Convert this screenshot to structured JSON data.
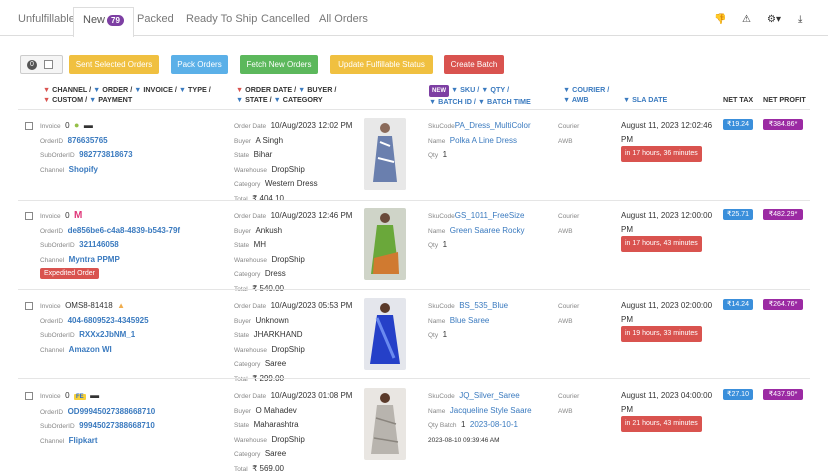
{
  "tabs": [
    {
      "label": "Unfulfillable"
    },
    {
      "label": "New",
      "count": "79"
    },
    {
      "label": "Packed"
    },
    {
      "label": "Ready To Ship"
    },
    {
      "label": "Cancelled"
    },
    {
      "label": "All Orders"
    }
  ],
  "selection_count": "0",
  "buttons": {
    "sent": "Sent Selected Orders",
    "pack": "Pack Orders",
    "fetch": "Fetch New Orders",
    "update": "Update Fulfillable Status",
    "batch": "Create Batch"
  },
  "colors": {
    "yellow": "#f0ad4e",
    "blue": "#5bc0de",
    "green": "#5cb85c",
    "red": "#d9534f",
    "purple": "#9b2aa3",
    "accent": "#3a7abf"
  },
  "headers": {
    "channel": "CHANNEL /",
    "order": "ORDER /",
    "invoice": "INVOICE /",
    "type": "TYPE /",
    "custom": "CUSTOM /",
    "payment": "PAYMENT",
    "order_date": "ORDER DATE /",
    "buyer": "BUYER /",
    "state": "STATE /",
    "category": "CATEGORY",
    "new_badge": "NEW",
    "sku": "SKU /",
    "qty": "QTY /",
    "batch_id": "BATCH ID /",
    "batch_time": "BATCH TIME",
    "courier": "COURIER /",
    "awb": "AWB",
    "sla_date": "SLA DATE",
    "net_tax": "NET TAX",
    "net_profit": "NET PROFIT"
  },
  "labels": {
    "invoice": "Invoice",
    "order_id": "OrderID",
    "suborder_id": "SubOrderID",
    "channel": "Channel",
    "order_date": "Order Date",
    "buyer": "Buyer",
    "state": "State",
    "warehouse": "Warehouse",
    "category": "Category",
    "total": "Total",
    "sku_code": "SkuCode",
    "name": "Name",
    "qty": "Qty",
    "qty_batch": "Qty Batch",
    "courier": "Courier",
    "awb": "AWB"
  },
  "orders": [
    {
      "invoice": "0",
      "order_id": "876635765",
      "suborder_id": "982773818673",
      "channel": "Shopify",
      "channel_icon": "shopify-icon",
      "order_date": "10/Aug/2023 12:02 PM",
      "buyer": "A Singh",
      "state": "Bihar",
      "warehouse": "DropShip",
      "category": "Western Dress",
      "total": "₹ 404.10",
      "sku": "PA_Dress_MultiColor",
      "name": "Polka A Line Dress",
      "qty": "1",
      "sla": "August 11, 2023 12:02:46 PM",
      "sla_remaining": "in 17 hours, 36 minutes",
      "net_tax": "₹19.24",
      "net_profit": "₹384.86*"
    },
    {
      "invoice": "0",
      "order_id": "de856be6-c4a8-4839-b543-79f",
      "suborder_id": "321146058",
      "channel": "Myntra PPMP",
      "channel_icon": "myntra-icon",
      "tag": "Expedited Order",
      "order_date": "10/Aug/2023 12:46 PM",
      "buyer": "Ankush",
      "state": "MH",
      "warehouse": "DropShip",
      "category": "Dress",
      "total": "₹ 540.00",
      "sku": "GS_1011_FreeSize",
      "name": "Green Saaree Rocky",
      "qty": "1",
      "sla": "August 11, 2023 12:00:00 PM",
      "sla_remaining": "in 17 hours, 43 minutes",
      "net_tax": "₹25.71",
      "net_profit": "₹482.29*"
    },
    {
      "invoice": "OMS8-81418",
      "order_id": "404-6809523-4345925",
      "suborder_id": "RXXx2JbNM_1",
      "channel": "Amazon WI",
      "channel_icon": "amazon-icon",
      "order_date": "10/Aug/2023 05:53 PM",
      "buyer": "Unknown",
      "state": "JHARKHAND",
      "warehouse": "DropShip",
      "category": "Saree",
      "total": "₹ 299.00",
      "sku": "BS_535_Blue",
      "name": "Blue Saree",
      "qty": "1",
      "sla": "August 11, 2023 02:00:00 PM",
      "sla_remaining": "in 19 hours, 33 minutes",
      "net_tax": "₹14.24",
      "net_profit": "₹264.76*"
    },
    {
      "invoice": "0",
      "order_id": "OD99945027388668710",
      "suborder_id": "99945027388668710",
      "channel": "Flipkart",
      "channel_icon": "flipkart-icon",
      "badge": "FE",
      "order_date": "10/Aug/2023 01:08 PM",
      "buyer": "O Mahadev",
      "state": "Maharashtra",
      "warehouse": "DropShip",
      "category": "Saree",
      "total": "₹ 569.00",
      "sku": "JQ_Silver_Saree",
      "name": "Jacqueline Style Saare",
      "qty": "1",
      "batch": "2023-08-10-1",
      "batch_time": "2023-08-10 09:39:46 AM",
      "sla": "August 11, 2023 04:00:00 PM",
      "sla_remaining": "in 21 hours, 43 minutes",
      "net_tax": "₹27.10",
      "net_profit": "₹437.90*"
    }
  ]
}
